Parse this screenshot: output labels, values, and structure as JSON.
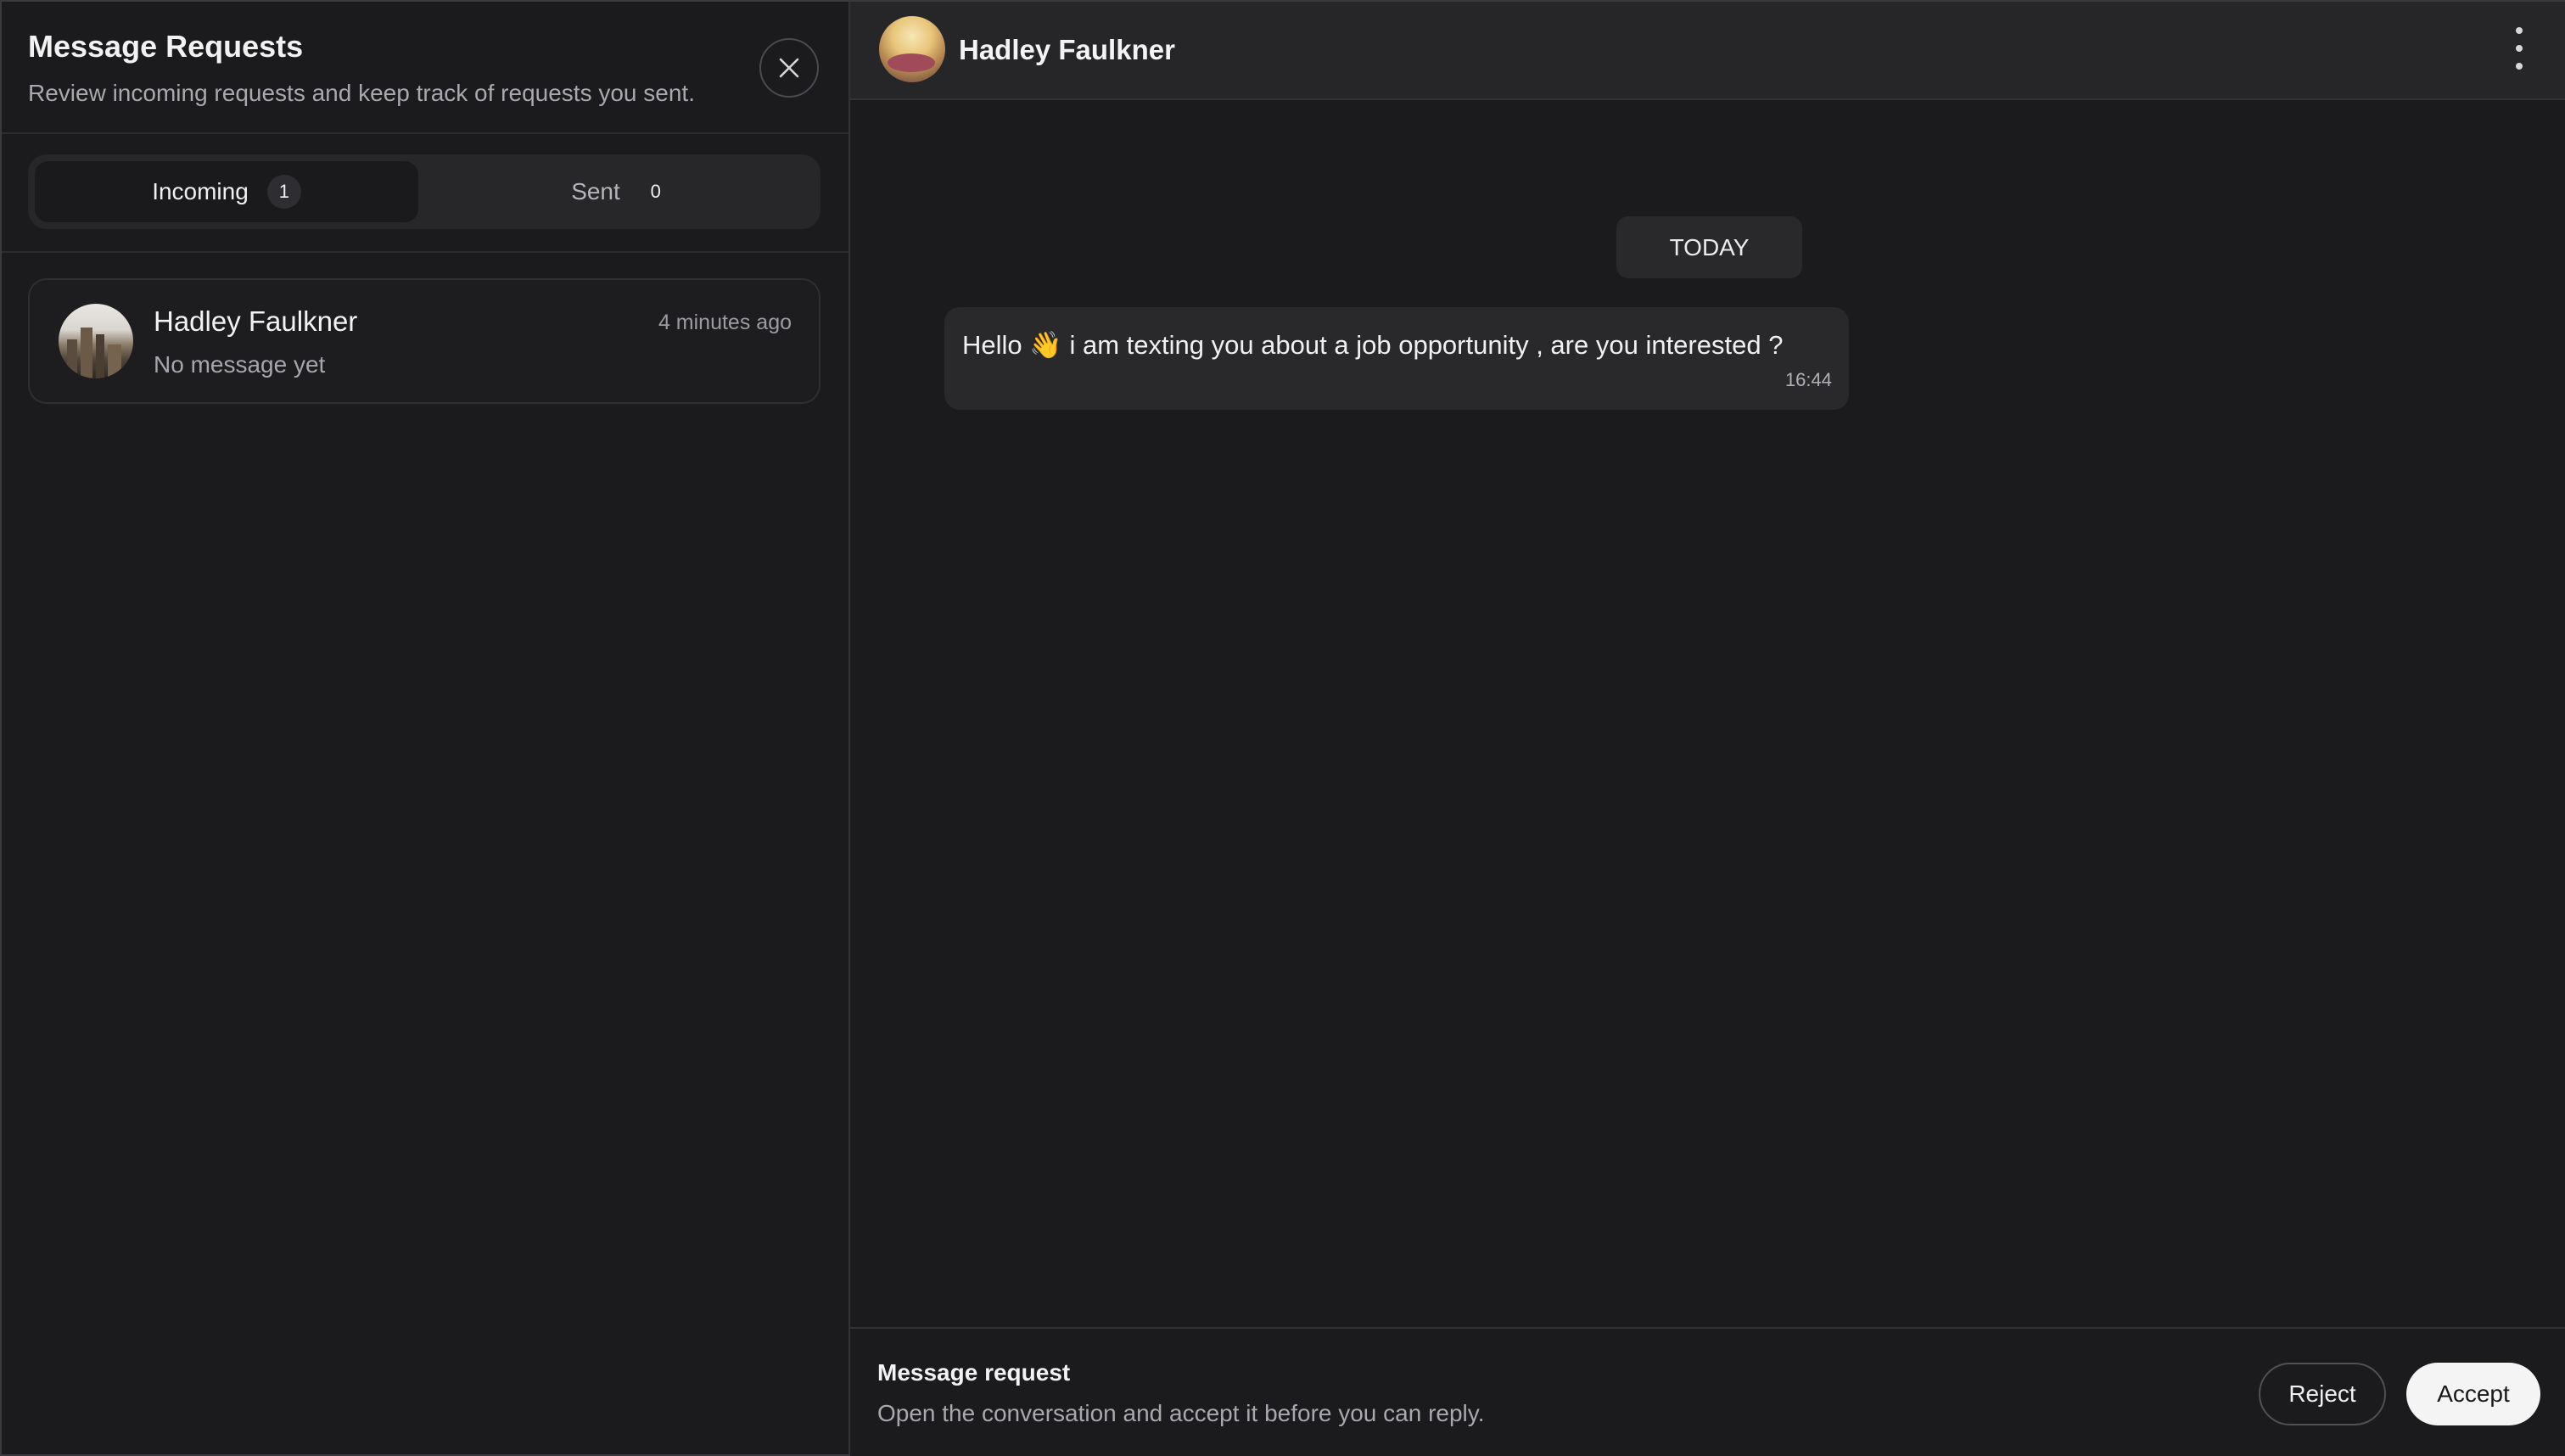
{
  "requests_panel": {
    "title": "Message Requests",
    "subtitle": "Review incoming requests and keep track of requests you sent.",
    "close_icon": "close-icon",
    "tabs": [
      {
        "label": "Incoming",
        "count": "1",
        "active": true
      },
      {
        "label": "Sent",
        "count": "0",
        "active": false
      }
    ],
    "requests": [
      {
        "name": "Hadley Faulkner",
        "time": "4 minutes ago",
        "preview": "No message yet"
      }
    ]
  },
  "chat": {
    "contact_name": "Hadley Faulkner",
    "menu_icon": "more-vertical-icon",
    "date_separator": "TODAY",
    "messages": [
      {
        "text": "Hello 👋 i am texting you about a job opportunity , are you interested ?",
        "time": "16:44"
      }
    ]
  },
  "request_footer": {
    "title": "Message request",
    "description": "Open the conversation and accept it before you can reply.",
    "reject_label": "Reject",
    "accept_label": "Accept"
  },
  "colors": {
    "background": "#1b1b1d",
    "surface": "#29292c",
    "accent_button": "#f4f4f5"
  }
}
